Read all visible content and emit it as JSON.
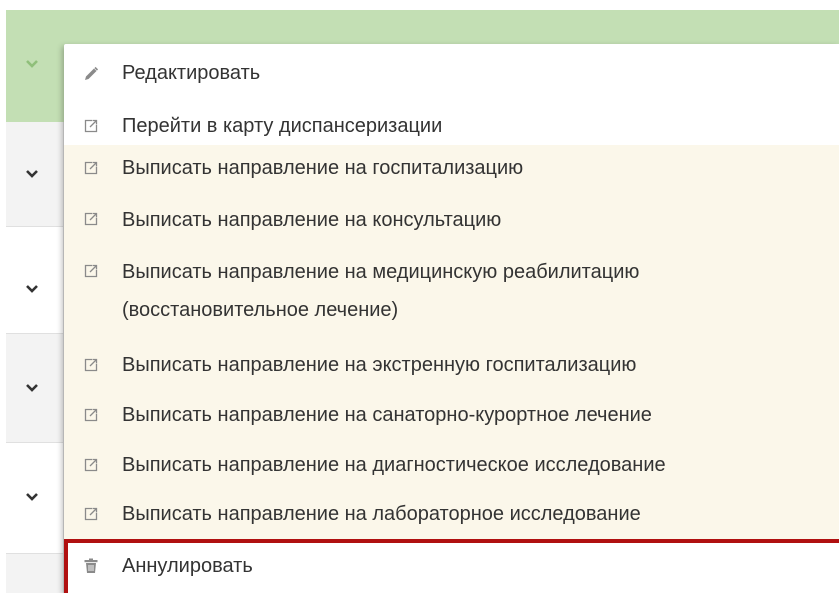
{
  "menu": {
    "items": [
      {
        "label": "Редактировать",
        "icon": "pencil-icon"
      },
      {
        "label": "Перейти в карту диспансеризации",
        "icon": "external-link-icon"
      },
      {
        "label": "Выписать направление на госпитализацию",
        "icon": "external-link-icon"
      },
      {
        "label": "Выписать направление на консультацию",
        "icon": "external-link-icon"
      },
      {
        "label": "Выписать направление на медицинскую реабилитацию",
        "label_line2": "(восстановительное лечение)",
        "icon": "external-link-icon"
      },
      {
        "label": "Выписать направление на экстренную госпитализацию",
        "icon": "external-link-icon"
      },
      {
        "label": "Выписать направление на санаторно-курортное лечение",
        "icon": "external-link-icon"
      },
      {
        "label": "Выписать направление на диагностическое исследование",
        "icon": "external-link-icon"
      },
      {
        "label": "Выписать направление на лабораторное исследование",
        "icon": "external-link-icon"
      },
      {
        "label": "Аннулировать",
        "icon": "trash-icon"
      }
    ]
  },
  "colors": {
    "header_bg": "#c3dfb4",
    "highlight_border": "#b01010",
    "menu_hover_bg": "#fbf7ea",
    "icon_gray": "#8a8a8a",
    "chevron": "#333333"
  }
}
